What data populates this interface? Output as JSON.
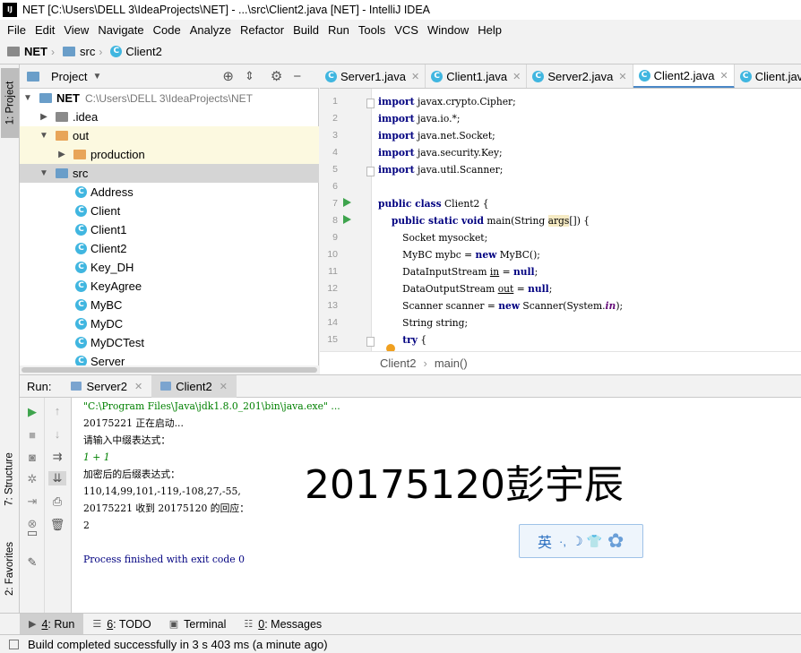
{
  "window": {
    "title": "NET [C:\\Users\\DELL 3\\IdeaProjects\\NET] - ...\\src\\Client2.java [NET] - IntelliJ IDEA",
    "logo": "IJ"
  },
  "menu": [
    "File",
    "Edit",
    "View",
    "Navigate",
    "Code",
    "Analyze",
    "Refactor",
    "Build",
    "Run",
    "Tools",
    "VCS",
    "Window",
    "Help"
  ],
  "breadcrumb": [
    "NET",
    "src",
    "Client2"
  ],
  "left_strip": {
    "project": "1: Project",
    "structure": "7: Structure",
    "favorites": "2: Favorites"
  },
  "project_panel": {
    "label": "Project",
    "root": {
      "name": "NET",
      "path": "C:\\Users\\DELL 3\\IdeaProjects\\NET"
    },
    "items": [
      {
        "name": ".idea"
      },
      {
        "name": "out"
      },
      {
        "name": "production"
      },
      {
        "name": "src"
      },
      {
        "name": "Address"
      },
      {
        "name": "Client"
      },
      {
        "name": "Client1"
      },
      {
        "name": "Client2"
      },
      {
        "name": "Key_DH"
      },
      {
        "name": "KeyAgree"
      },
      {
        "name": "MyBC"
      },
      {
        "name": "MyDC"
      },
      {
        "name": "MyDCTest"
      },
      {
        "name": "Server"
      }
    ]
  },
  "editor": {
    "tabs": [
      "Server1.java",
      "Client1.java",
      "Server2.java",
      "Client2.java",
      "Client.java"
    ],
    "active_tab": "Client2.java",
    "line_numbers": [
      "1",
      "2",
      "3",
      "4",
      "5",
      "6",
      "7",
      "8",
      "9",
      "10",
      "11",
      "12",
      "13",
      "14",
      "15"
    ],
    "code": {
      "l1a": "import",
      "l1b": " javax.crypto.Cipher;",
      "l2a": "import",
      "l2b": " java.io.*;",
      "l3a": "import",
      "l3b": " java.net.Socket;",
      "l4a": "import",
      "l4b": " java.security.Key;",
      "l5a": "import",
      "l5b": " java.util.Scanner;",
      "l7a": "public class",
      "l7b": " Client2 {",
      "l8a": "    public static void",
      "l8b": " main(String ",
      "l8c": "args",
      "l8d": "[]) {",
      "l9": "        Socket mysocket;",
      "l10a": "        MyBC mybc = ",
      "l10b": "new",
      "l10c": " MyBC();",
      "l11a": "        DataInputStream ",
      "l11b": "in",
      "l11c": " = ",
      "l11d": "null",
      "l11e": ";",
      "l12a": "        DataOutputStream ",
      "l12b": "out",
      "l12c": " = ",
      "l12d": "null",
      "l12e": ";",
      "l13a": "        Scanner scanner = ",
      "l13b": "new",
      "l13c": " Scanner(System.",
      "l13d": "in",
      "l13e": ");",
      "l14": "        String string;",
      "l15a": "        ",
      "l15b": "try",
      "l15c": " {"
    },
    "breadcrumb": [
      "Client2",
      "main()"
    ]
  },
  "run_panel": {
    "label": "Run:",
    "tabs": [
      "Server2",
      "Client2"
    ],
    "console": [
      "\"C:\\Program Files\\Java\\jdk1.8.0_201\\bin\\java.exe\" ...",
      "20175221 正在启动...",
      "请输入中缀表达式：",
      "1 + 1",
      "加密后的后缀表达式：",
      "110,14,99,101,-119,-108,27,-55,",
      "20175221 收到 20175120 的回应：",
      "2",
      "",
      "Process finished with exit code 0"
    ],
    "overlay_text": "20175120彭宇辰",
    "ime_text": "英"
  },
  "bottom_tabs": [
    {
      "key": "4",
      "label": ": Run"
    },
    {
      "key": "6",
      "label": ": TODO"
    },
    {
      "key": "",
      "label": "Terminal"
    },
    {
      "key": "0",
      "label": ": Messages"
    }
  ],
  "status": "Build completed successfully in 3 s 403 ms (a minute ago)",
  "colors": {
    "keyword": "#000080",
    "field": "#660e7a",
    "string": "#008000",
    "run_green": "#3ea44d",
    "class_icon": "#40b6e0"
  }
}
